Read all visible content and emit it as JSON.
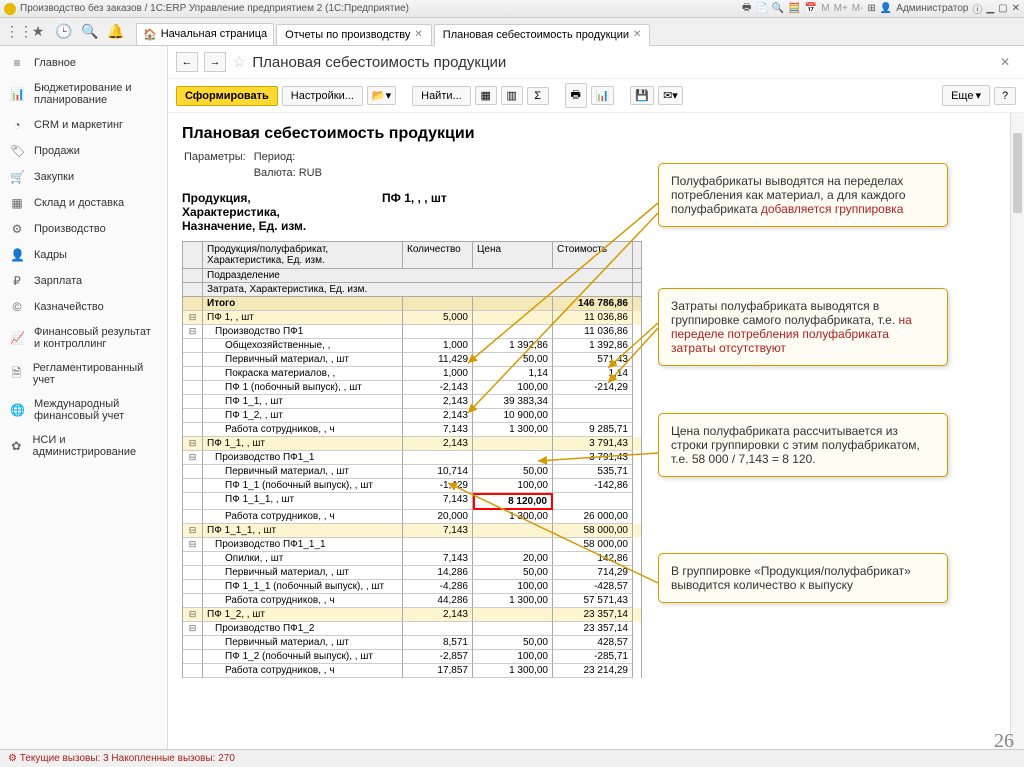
{
  "window_title": "Производство без заказов / 1С:ERP Управление предприятием 2  (1С:Предприятие)",
  "user": "Администратор",
  "tabs": {
    "home": "Начальная страница",
    "t1": "Отчеты по производству",
    "t2": "Плановая себестоимость продукции"
  },
  "sidebar": [
    {
      "ico": "≡",
      "label": "Главное"
    },
    {
      "ico": "📊",
      "label": "Бюджетирование и планирование"
    },
    {
      "ico": "◔",
      "label": "CRM и маркетинг"
    },
    {
      "ico": "🏷",
      "label": "Продажи"
    },
    {
      "ico": "🛒",
      "label": "Закупки"
    },
    {
      "ico": "▦",
      "label": "Склад и доставка"
    },
    {
      "ico": "⚙",
      "label": "Производство"
    },
    {
      "ico": "👤",
      "label": "Кадры"
    },
    {
      "ico": "₽",
      "label": "Зарплата"
    },
    {
      "ico": "©",
      "label": "Казначейство"
    },
    {
      "ico": "📈",
      "label": "Финансовый результат и контроллинг"
    },
    {
      "ico": "🗎",
      "label": "Регламентированный учет"
    },
    {
      "ico": "🌐",
      "label": "Международный финансовый учет"
    },
    {
      "ico": "✿",
      "label": "НСИ и администрирование"
    }
  ],
  "page_title": "Плановая себестоимость продукции",
  "toolbar": {
    "run": "Сформировать",
    "settings": "Настройки...",
    "find": "Найти...",
    "more": "Еще"
  },
  "report": {
    "title": "Плановая себестоимость продукции",
    "params_label": "Параметры:",
    "period_label": "Период:",
    "currency_label": "Валюта: RUB",
    "product_header": "Продукция, Характеристика, Назначение, Ед. изм.",
    "product_value": "ПФ 1, , , шт",
    "columns": {
      "c1": "Продукция/полуфабрикат, Характеристика, Ед. изм.",
      "c2": "Количество",
      "c3": "Цена",
      "c4": "Стоимость"
    },
    "sub1": "Подразделение",
    "sub2": "Затрата, Характеристика, Ед. изм."
  },
  "rows": [
    {
      "cls": "total",
      "name": "Итого",
      "qty": "",
      "price": "",
      "cost": "146 786,86"
    },
    {
      "cls": "lvl1",
      "tog": "⊟",
      "name": "ПФ 1, , шт",
      "qty": "5,000",
      "price": "",
      "cost": "11 036,86",
      "ind": 0
    },
    {
      "cls": "lvl2",
      "tog": "⊟",
      "name": "Производство ПФ1",
      "qty": "",
      "price": "",
      "cost": "11 036,86",
      "ind": 1
    },
    {
      "cls": "lvl3",
      "name": "Общехозяйственные, ,",
      "qty": "1,000",
      "price": "1 392,86",
      "cost": "1 392,86",
      "ind": 2
    },
    {
      "cls": "lvl3",
      "name": "Первичный материал, , шт",
      "qty": "11,429",
      "price": "50,00",
      "cost": "571,43",
      "ind": 2
    },
    {
      "cls": "lvl3",
      "name": "Покраска материалов, ,",
      "qty": "1,000",
      "price": "1,14",
      "cost": "1,14",
      "ind": 2
    },
    {
      "cls": "lvl3",
      "name": "ПФ 1 (побочный выпуск), , шт",
      "qty": "-2,143",
      "price": "100,00",
      "cost": "-214,29",
      "ind": 2
    },
    {
      "cls": "lvl3",
      "name": "ПФ 1_1, , шт",
      "qty": "2,143",
      "price": "39 383,34",
      "cost": "",
      "ind": 2
    },
    {
      "cls": "lvl3",
      "name": "ПФ 1_2, , шт",
      "qty": "2,143",
      "price": "10 900,00",
      "cost": "",
      "ind": 2
    },
    {
      "cls": "lvl3",
      "name": "Работа сотрудников, , ч",
      "qty": "7,143",
      "price": "1 300,00",
      "cost": "9 285,71",
      "ind": 2
    },
    {
      "cls": "lvl1",
      "tog": "⊟",
      "name": "ПФ 1_1, , шт",
      "qty": "2,143",
      "price": "",
      "cost": "3 791,43",
      "ind": 0
    },
    {
      "cls": "lvl2",
      "tog": "⊟",
      "name": "Производство ПФ1_1",
      "qty": "",
      "price": "",
      "cost": "3 791,43",
      "ind": 1
    },
    {
      "cls": "lvl3",
      "name": "Первичный материал, , шт",
      "qty": "10,714",
      "price": "50,00",
      "cost": "535,71",
      "ind": 2
    },
    {
      "cls": "lvl3",
      "name": "ПФ 1_1 (побочный выпуск), , шт",
      "qty": "-1,429",
      "price": "100,00",
      "cost": "-142,86",
      "ind": 2
    },
    {
      "cls": "lvl3",
      "name": "ПФ 1_1_1, , шт",
      "qty": "7,143",
      "price": "8 120,00",
      "cost": "",
      "ind": 2,
      "hl": true
    },
    {
      "cls": "lvl3",
      "name": "Работа сотрудников, , ч",
      "qty": "20,000",
      "price": "1 300,00",
      "cost": "26 000,00",
      "ind": 2
    },
    {
      "cls": "lvl1",
      "tog": "⊟",
      "name": "ПФ 1_1_1, , шт",
      "qty": "7,143",
      "price": "",
      "cost": "58 000,00",
      "ind": 0
    },
    {
      "cls": "lvl2",
      "tog": "⊟",
      "name": "Производство ПФ1_1_1",
      "qty": "",
      "price": "",
      "cost": "58 000,00",
      "ind": 1
    },
    {
      "cls": "lvl3",
      "name": "Опилки, , шт",
      "qty": "7,143",
      "price": "20,00",
      "cost": "142,86",
      "ind": 2
    },
    {
      "cls": "lvl3",
      "name": "Первичный материал, , шт",
      "qty": "14,286",
      "price": "50,00",
      "cost": "714,29",
      "ind": 2
    },
    {
      "cls": "lvl3",
      "name": "ПФ 1_1_1 (побочный выпуск), , шт",
      "qty": "-4,286",
      "price": "100,00",
      "cost": "-428,57",
      "ind": 2
    },
    {
      "cls": "lvl3",
      "name": "Работа сотрудников, , ч",
      "qty": "44,286",
      "price": "1 300,00",
      "cost": "57 571,43",
      "ind": 2
    },
    {
      "cls": "lvl1",
      "tog": "⊟",
      "name": "ПФ 1_2, , шт",
      "qty": "2,143",
      "price": "",
      "cost": "23 357,14",
      "ind": 0
    },
    {
      "cls": "lvl2",
      "tog": "⊟",
      "name": "Производство ПФ1_2",
      "qty": "",
      "price": "",
      "cost": "23 357,14",
      "ind": 1
    },
    {
      "cls": "lvl3",
      "name": "Первичный материал, , шт",
      "qty": "8,571",
      "price": "50,00",
      "cost": "428,57",
      "ind": 2
    },
    {
      "cls": "lvl3",
      "name": "ПФ 1_2 (побочный выпуск), , шт",
      "qty": "-2,857",
      "price": "100,00",
      "cost": "-285,71",
      "ind": 2
    },
    {
      "cls": "lvl3",
      "name": "Работа сотрудников, , ч",
      "qty": "17,857",
      "price": "1 300,00",
      "cost": "23 214,29",
      "ind": 2
    }
  ],
  "callouts": {
    "c1": {
      "t1": "Полуфабрикаты выводятся на переделах потребления как материал, а для каждого полуфабриката ",
      "t2": "добавляется группировка"
    },
    "c2": {
      "t1": "Затраты полуфабриката выводятся в группировке самого полуфабриката, т.е. ",
      "t2": "на переделе потребления полуфабриката затраты отсутствуют"
    },
    "c3": "Цена полуфабриката рассчитывается из строки группировки с этим полуфабрикатом, т.е. 58 000 / 7,143 = 8 120.",
    "c4": "В группировке «Продукция/полуфабрикат» выводится количество к выпуску"
  },
  "status": "Текущие вызовы: 3   Накопленные вызовы: 270",
  "slide": "26"
}
